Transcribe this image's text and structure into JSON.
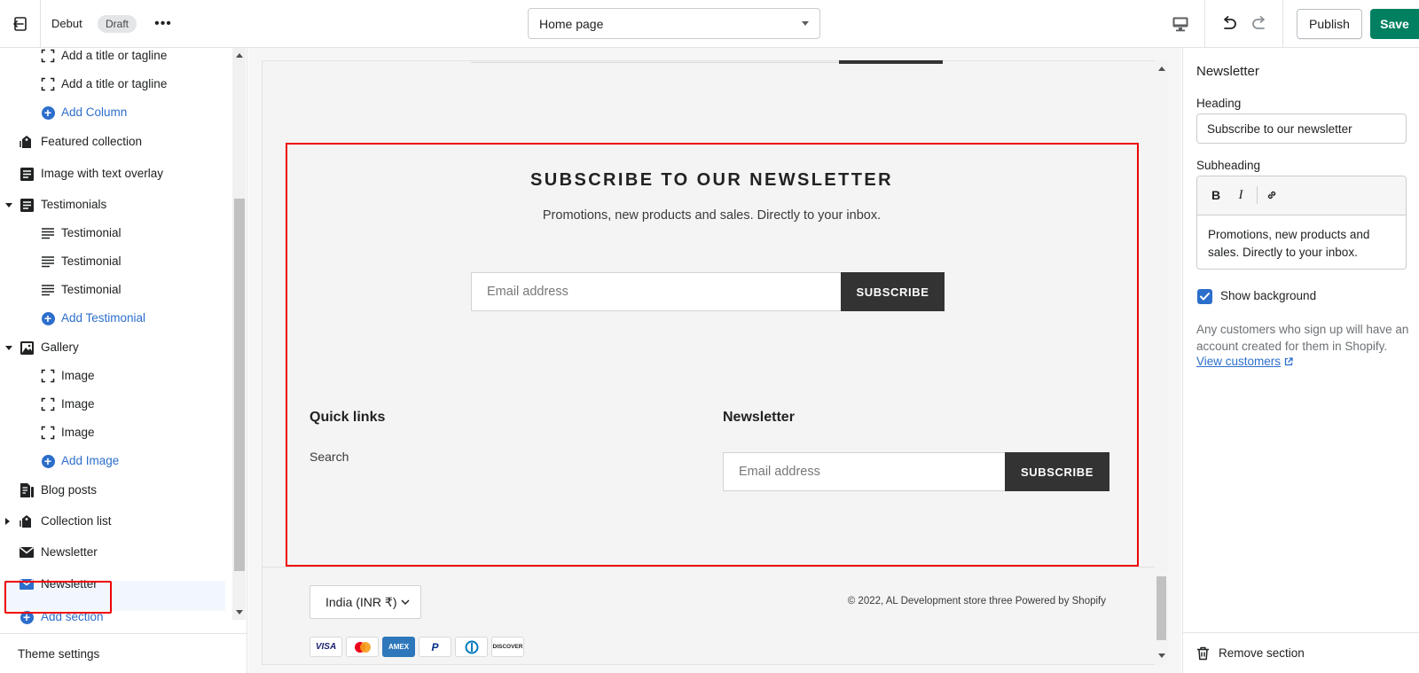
{
  "topbar": {
    "theme_name": "Debut",
    "draft_badge": "Draft",
    "more": "•••",
    "page_selector": "Home page",
    "publish_label": "Publish",
    "save_label": "Save"
  },
  "sidebar": {
    "items": [
      {
        "label": "Add a title or tagline",
        "icon": "block-dashed-icon",
        "level": 2,
        "style": "normal"
      },
      {
        "label": "Add a title or tagline",
        "icon": "block-dashed-icon",
        "level": 2,
        "style": "normal"
      },
      {
        "label": "Add Column",
        "icon": "plus-circle-icon",
        "level": 2,
        "style": "link"
      },
      {
        "label": "Featured collection",
        "icon": "collection-tag-icon",
        "level": 1,
        "style": "normal"
      },
      {
        "label": "Image with text overlay",
        "icon": "text-block-icon",
        "level": 1,
        "style": "normal"
      },
      {
        "label": "Testimonials",
        "icon": "text-block-icon",
        "level": 1,
        "style": "normal",
        "expanded": true
      },
      {
        "label": "Testimonial",
        "icon": "text-lines-icon",
        "level": 2,
        "style": "normal"
      },
      {
        "label": "Testimonial",
        "icon": "text-lines-icon",
        "level": 2,
        "style": "normal"
      },
      {
        "label": "Testimonial",
        "icon": "text-lines-icon",
        "level": 2,
        "style": "normal"
      },
      {
        "label": "Add Testimonial",
        "icon": "plus-circle-icon",
        "level": 2,
        "style": "link"
      },
      {
        "label": "Gallery",
        "icon": "image-icon",
        "level": 1,
        "style": "normal",
        "expanded": true
      },
      {
        "label": "Image",
        "icon": "block-dashed-icon",
        "level": 2,
        "style": "normal"
      },
      {
        "label": "Image",
        "icon": "block-dashed-icon",
        "level": 2,
        "style": "normal"
      },
      {
        "label": "Image",
        "icon": "block-dashed-icon",
        "level": 2,
        "style": "normal"
      },
      {
        "label": "Add Image",
        "icon": "plus-circle-icon",
        "level": 2,
        "style": "link"
      },
      {
        "label": "Blog posts",
        "icon": "blog-icon",
        "level": 1,
        "style": "normal"
      },
      {
        "label": "Collection list",
        "icon": "collection-tag-icon",
        "level": 1,
        "style": "normal",
        "expanded": false
      },
      {
        "label": "Newsletter",
        "icon": "envelope-icon",
        "level": 1,
        "style": "normal"
      },
      {
        "label": "Newsletter",
        "icon": "envelope-icon",
        "level": 1,
        "style": "selected"
      },
      {
        "label": "Add section",
        "icon": "plus-circle-icon",
        "level": 1,
        "style": "link"
      }
    ],
    "theme_settings": "Theme settings"
  },
  "preview": {
    "newsletter_title": "SUBSCRIBE TO OUR NEWSLETTER",
    "newsletter_subtitle": "Promotions, new products and sales. Directly to your inbox.",
    "email_placeholder": "Email address",
    "subscribe_label": "SUBSCRIBE",
    "footer": {
      "quick_links_heading": "Quick links",
      "quick_links": [
        "Search"
      ],
      "newsletter_heading": "Newsletter",
      "email_placeholder": "Email address",
      "subscribe_label": "SUBSCRIBE",
      "currency": "India (INR ₹)",
      "copyright": "© 2022, AL Development store three Powered by Shopify",
      "payment_methods": [
        "VISA",
        "Mastercard",
        "AMEX",
        "PayPal",
        "Diners Club",
        "DISCOVER"
      ]
    }
  },
  "settings": {
    "panel_title": "Newsletter",
    "heading_label": "Heading",
    "heading_value": "Subscribe to our newsletter",
    "subheading_label": "Subheading",
    "subheading_value": "Promotions, new products and sales. Directly to your inbox.",
    "bold": "B",
    "italic": "I",
    "show_background_label": "Show background",
    "show_background_checked": true,
    "help_text": "Any customers who sign up will have an account created for them in Shopify.",
    "view_customers_link": "View customers",
    "remove_section_label": "Remove section"
  },
  "colors": {
    "accent_blue": "#2c6ecb",
    "save_green": "#008060",
    "subscribe_dark": "#333333",
    "highlight_red": "#e00000"
  }
}
